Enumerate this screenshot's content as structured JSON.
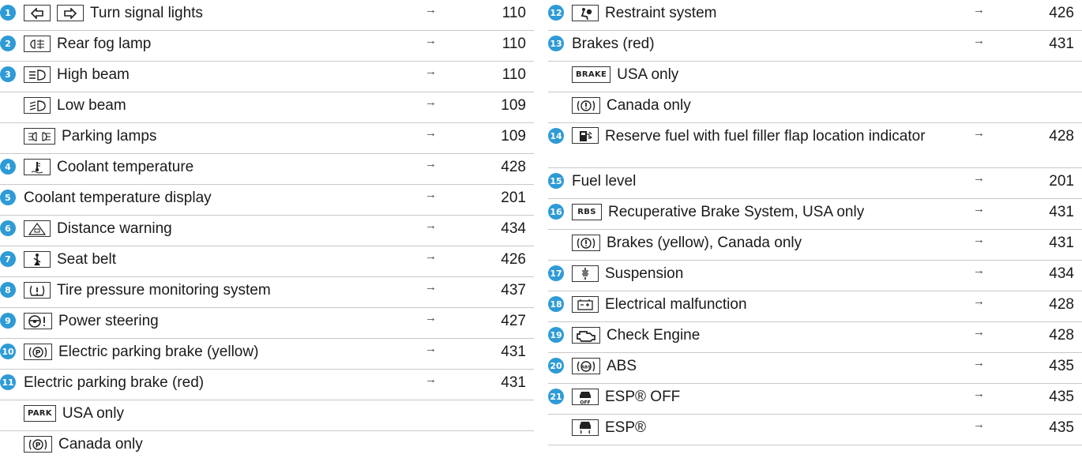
{
  "left_rows": [
    {
      "num": "1",
      "icons": [
        "turn-left",
        "turn-right"
      ],
      "label": "Turn signal lights",
      "page": "110"
    },
    {
      "num": "2",
      "icons": [
        "rear-fog"
      ],
      "label": "Rear fog lamp",
      "page": "110"
    },
    {
      "num": "3",
      "icons": [
        "high-beam"
      ],
      "label": "High beam",
      "page": "110"
    },
    {
      "num": "",
      "icons": [
        "low-beam"
      ],
      "label": "Low beam",
      "page": "109"
    },
    {
      "num": "",
      "icons": [
        "parking-lamps"
      ],
      "label": "Parking lamps",
      "page": "109"
    },
    {
      "num": "4",
      "icons": [
        "coolant"
      ],
      "label": "Coolant temperature",
      "page": "428"
    },
    {
      "num": "5",
      "icons": [],
      "label": "Coolant temperature display",
      "page": "201"
    },
    {
      "num": "6",
      "icons": [
        "distance"
      ],
      "label": "Distance warning",
      "page": "434"
    },
    {
      "num": "7",
      "icons": [
        "seat-belt"
      ],
      "label": "Seat belt",
      "page": "426"
    },
    {
      "num": "8",
      "icons": [
        "tire-pressure"
      ],
      "label": "Tire pressure monitoring system",
      "page": "437"
    },
    {
      "num": "9",
      "icons": [
        "power-steering"
      ],
      "label": "Power steering",
      "page": "427"
    },
    {
      "num": "10",
      "icons": [
        "parking-brake"
      ],
      "label": "Electric parking brake (yellow)",
      "page": "431"
    },
    {
      "num": "11",
      "icons": [],
      "label": "Electric parking brake (red)",
      "page": "431"
    },
    {
      "num": "",
      "icons": [
        "PARK"
      ],
      "label": "USA only",
      "page": ""
    },
    {
      "num": "",
      "icons": [
        "parking-brake"
      ],
      "label": "Canada only",
      "page": ""
    }
  ],
  "right_rows": [
    {
      "num": "12",
      "icons": [
        "restraint"
      ],
      "label": "Restraint system",
      "page": "426"
    },
    {
      "num": "13",
      "icons": [],
      "label": "Brakes (red)",
      "page": "431"
    },
    {
      "num": "",
      "icons": [
        "BRAKE"
      ],
      "label": "USA only",
      "page": ""
    },
    {
      "num": "",
      "icons": [
        "brake-circle"
      ],
      "label": "Canada only",
      "page": ""
    },
    {
      "num": "14",
      "icons": [
        "fuel"
      ],
      "label": "Reserve fuel with fuel filler flap location indicator",
      "page": "428"
    },
    {
      "num": "15",
      "icons": [],
      "label": "Fuel level",
      "page": "201"
    },
    {
      "num": "16",
      "icons": [
        "RBS"
      ],
      "label": "Recuperative Brake System, USA only",
      "page": "431"
    },
    {
      "num": "",
      "icons": [
        "brake-circle"
      ],
      "label": "Brakes (yellow), Canada only",
      "page": "431"
    },
    {
      "num": "17",
      "icons": [
        "suspension"
      ],
      "label": "Suspension",
      "page": "434"
    },
    {
      "num": "18",
      "icons": [
        "battery"
      ],
      "label": "Electrical malfunction",
      "page": "428"
    },
    {
      "num": "19",
      "icons": [
        "engine"
      ],
      "label": "Check Engine",
      "page": "428"
    },
    {
      "num": "20",
      "icons": [
        "abs"
      ],
      "label": "ABS",
      "page": "435"
    },
    {
      "num": "21",
      "icons": [
        "esp-off"
      ],
      "label": "ESP® OFF",
      "page": "435"
    },
    {
      "num": "",
      "icons": [
        "esp"
      ],
      "label": "ESP®",
      "page": "435"
    }
  ],
  "arrow_glyph": "→",
  "accent_color": "#2e9bd6"
}
